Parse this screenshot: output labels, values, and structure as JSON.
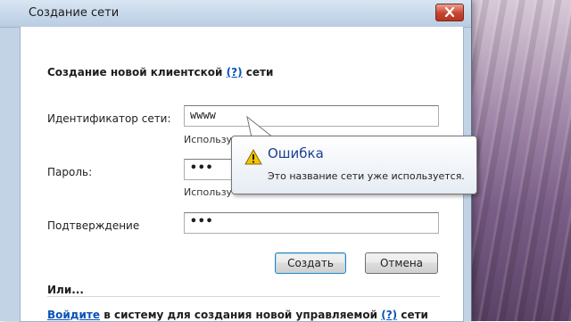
{
  "window": {
    "title": "Создание сети",
    "close_icon": "close-icon"
  },
  "form": {
    "heading_prefix": "Создание новой клиентской",
    "heading_help": "(?)",
    "heading_suffix": "сети",
    "network_id": {
      "label": "Идентификатор сети:",
      "value": "wwww",
      "hint": "Использу"
    },
    "password": {
      "label": "Пароль:",
      "value": "•••",
      "hint": "Использу"
    },
    "confirm": {
      "label": "Подтверждение",
      "value": "•••"
    },
    "create_label": "Создать",
    "cancel_label": "Отмена",
    "or_label": "Или...",
    "signin_link": "Войдите",
    "signin_text": "в систему для создания новой управляемой",
    "signin_help": "(?)",
    "signin_suffix": "сети"
  },
  "error_tooltip": {
    "icon": "warning-icon",
    "title": "Ошибка",
    "message": "Это название сети уже используется."
  },
  "colors": {
    "link": "#0a52b8",
    "tooltip_title": "#1c3f94",
    "close_button": "#c7442e"
  }
}
